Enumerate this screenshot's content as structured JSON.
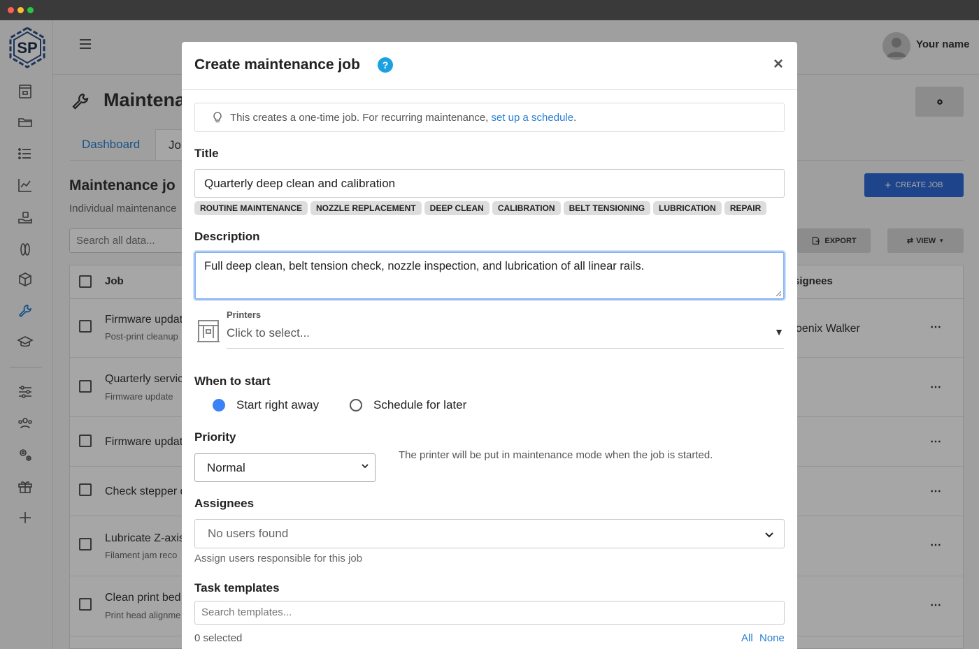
{
  "user": {
    "name": "Your name"
  },
  "logo": {
    "text": "SP"
  },
  "page": {
    "title": "Maintena",
    "tabs": [
      "Dashboard",
      "Jo"
    ],
    "section_title": "Maintenance jo",
    "section_sub": "Individual maintenance",
    "search_placeholder": "Search all data...",
    "create_label": "CREATE JOB",
    "export_label": "EXPORT",
    "view_label": "VIEW",
    "columns": {
      "job": "Job",
      "assignees": "signees"
    },
    "rows": [
      {
        "title": "Firmware updat",
        "sub": "Post-print cleanup",
        "assignee": "oenix Walker"
      },
      {
        "title": "Quarterly servic",
        "sub": "Firmware update",
        "assignee": ""
      },
      {
        "title": "Firmware updat",
        "sub": "",
        "assignee": ""
      },
      {
        "title": "Check stepper d",
        "sub": "",
        "assignee": ""
      },
      {
        "title": "Lubricate Z-axis",
        "sub": "Filament jam reco",
        "assignee": ""
      },
      {
        "title": "Clean print bed",
        "sub": "Print head alignme",
        "assignee": ""
      }
    ]
  },
  "modal": {
    "title": "Create maintenance job",
    "help": "?",
    "close": "×",
    "info_text": "This creates a one-time job. For recurring maintenance, ",
    "info_link": "set up a schedule",
    "info_end": ".",
    "title_label": "Title",
    "title_value": "Quarterly deep clean and calibration",
    "chips": [
      "ROUTINE MAINTENANCE",
      "NOZZLE REPLACEMENT",
      "DEEP CLEAN",
      "CALIBRATION",
      "BELT TENSIONING",
      "LUBRICATION",
      "REPAIR"
    ],
    "description_label": "Description",
    "description_value": "Full deep clean, belt tension check, nozzle inspection, and lubrication of all linear rails.",
    "printers_label": "Printers",
    "printers_placeholder": "Click to select...",
    "when_label": "When to start",
    "when_options": [
      "Start right away",
      "Schedule for later"
    ],
    "priority_label": "Priority",
    "priority_value": "Normal",
    "priority_note": "The printer will be put in maintenance mode when the job is started.",
    "assignees_label": "Assignees",
    "assignees_value": "No users found",
    "assignees_help": "Assign users responsible for this job",
    "templates_label": "Task templates",
    "templates_placeholder": "Search templates...",
    "selected_count": "0 selected",
    "link_all": "All",
    "link_none": "None"
  }
}
